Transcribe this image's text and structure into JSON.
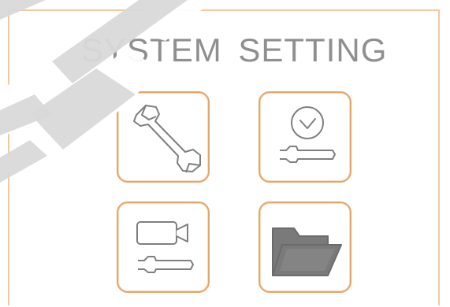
{
  "dialog": {
    "title": "SYSTEM  SETTING"
  },
  "tiles": [
    {
      "icon": "wrench-icon"
    },
    {
      "icon": "clock-wrench-icon"
    },
    {
      "icon": "camera-wrench-icon"
    },
    {
      "icon": "folder-icon"
    }
  ],
  "colors": {
    "frame_border": "#f0c9a2",
    "tile_border": "#e2a66a",
    "title_text": "#8f8f8f",
    "icon_stroke": "#7f7f7f",
    "folder_fill": "#7a7a7a",
    "watermark": "#d9d9d9"
  }
}
